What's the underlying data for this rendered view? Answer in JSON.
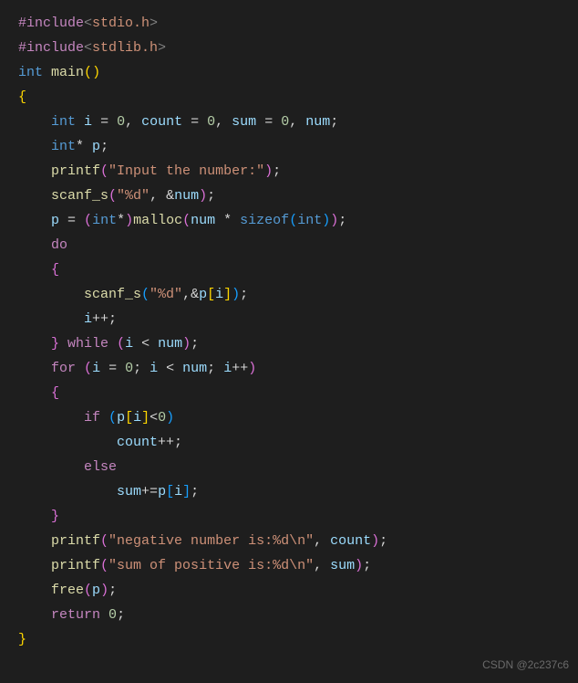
{
  "code": {
    "l1": {
      "pre": "#include",
      "open": "<",
      "hdr": "stdio.h",
      "close": ">"
    },
    "l2": {
      "pre": "#include",
      "open": "<",
      "hdr": "stdlib.h",
      "close": ">"
    },
    "l3": {
      "kw": "int",
      "fn": "main",
      "op": "(",
      "cl": ")"
    },
    "l4": {
      "br": "{"
    },
    "l5": {
      "kw": "int",
      "v1": "i",
      "eq1": " = ",
      "n1": "0",
      "c1": ", ",
      "v2": "count",
      "eq2": " = ",
      "n2": "0",
      "c2": ", ",
      "v3": "sum",
      "eq3": " = ",
      "n3": "0",
      "c3": ", ",
      "v4": "num",
      "end": ";"
    },
    "l6": {
      "kw": "int",
      "star": "* ",
      "v": "p",
      "end": ";"
    },
    "l7": {
      "fn": "printf",
      "op": "(",
      "str": "\"Input the number:\"",
      "cl": ")",
      "end": ";"
    },
    "l8": {
      "fn": "scanf_s",
      "op": "(",
      "str": "\"%d\"",
      "c": ", ",
      "amp": "&",
      "v": "num",
      "cl": ")",
      "end": ";"
    },
    "l9": {
      "v": "p",
      "eq": " = ",
      "op1": "(",
      "kw1": "int",
      "star": "*",
      "cl1": ")",
      "fn": "malloc",
      "op2": "(",
      "v2": "num",
      "mul": " * ",
      "kw2": "sizeof",
      "op3": "(",
      "kw3": "int",
      "cl3": ")",
      "cl2": ")",
      "end": ";"
    },
    "l10": {
      "kw": "do"
    },
    "l11": {
      "br": "{"
    },
    "l12": {
      "fn": "scanf_s",
      "op": "(",
      "str": "\"%d\"",
      "c": ",",
      "amp": "&",
      "v": "p",
      "ob": "[",
      "v2": "i",
      "cb": "]",
      "cl": ")",
      "end": ";"
    },
    "l13": {
      "v": "i",
      "op": "++;"
    },
    "l14": {
      "br": "}",
      "sp": " ",
      "kw": "while",
      "sp2": " ",
      "op": "(",
      "v": "i",
      "lt": " < ",
      "v2": "num",
      "cl": ")",
      "end": ";"
    },
    "l15": {
      "kw": "for",
      "sp": " ",
      "op": "(",
      "v1": "i",
      "eq": " = ",
      "n": "0",
      "c1": "; ",
      "v2": "i",
      "lt": " < ",
      "v3": "num",
      "c2": "; ",
      "v4": "i",
      "inc": "++",
      "cl": ")"
    },
    "l16": {
      "br": "{"
    },
    "l17": {
      "kw": "if",
      "sp": " ",
      "op": "(",
      "v": "p",
      "ob": "[",
      "v2": "i",
      "cb": "]",
      "lt": "<",
      "n": "0",
      "cl": ")"
    },
    "l18": {
      "v": "count",
      "op": "++;"
    },
    "l19": {
      "kw": "else"
    },
    "l20": {
      "v": "sum",
      "op": "+=",
      "v2": "p",
      "ob": "[",
      "v3": "i",
      "cb": "]",
      "end": ";"
    },
    "l21": {
      "br": "}"
    },
    "l22": {
      "fn": "printf",
      "op": "(",
      "str": "\"negative number is:%d\\n\"",
      "c": ", ",
      "v": "count",
      "cl": ")",
      "end": ";"
    },
    "l23": {
      "fn": "printf",
      "op": "(",
      "str": "\"sum of positive is:%d\\n\"",
      "c": ", ",
      "v": "sum",
      "cl": ")",
      "end": ";"
    },
    "l24": {
      "fn": "free",
      "op": "(",
      "v": "p",
      "cl": ")",
      "end": ";"
    },
    "l25": {
      "kw": "return",
      "sp": " ",
      "n": "0",
      "end": ";"
    },
    "l26": {
      "br": "}"
    }
  },
  "watermark": "CSDN @2c237c6"
}
